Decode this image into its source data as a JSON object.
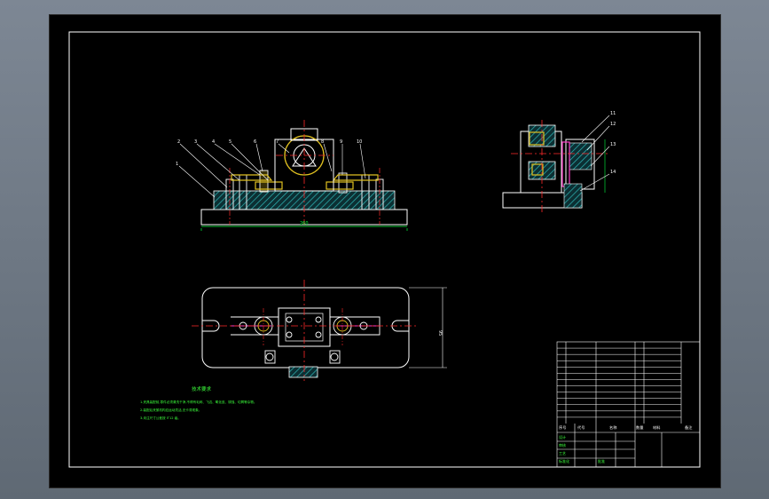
{
  "colors": {
    "frame": "#ffffff",
    "outline": "#ffffff",
    "centerline": "#ff2a2a",
    "hatch": "#2fb8b8",
    "part_yellow": "#e0c020",
    "part_magenta": "#ff3cc8",
    "dimension": "#00ff40",
    "notes": "#3cff3c"
  },
  "front_view": {
    "balloons": [
      "2",
      "3",
      "4",
      "5",
      "6",
      "7",
      "8",
      "9",
      "10",
      "1"
    ],
    "width_dim": "260"
  },
  "plan_view": {
    "height_dim": "95"
  },
  "side_view": {
    "balloons": [
      "11",
      "12",
      "13",
      "14"
    ]
  },
  "tech_notes": {
    "title": "技术要求",
    "lines": [
      "1.夹具装配前,零件必须清洗干净,不得有毛刺、飞边、氧化皮、锈蚀、切屑等杂物。",
      "2.装配后夹紧机构应运动灵活,无卡滞现象。",
      "3.未注尺寸公差按 IT12 级。"
    ]
  },
  "title_block": {
    "header": {
      "no": "序号",
      "code": "代号",
      "name": "名称",
      "qty": "数量",
      "material": "材料",
      "remark": "备注"
    },
    "rows": 12,
    "bottom_labels": [
      "设计",
      "审核",
      "工艺",
      "标准化",
      "批准"
    ]
  }
}
